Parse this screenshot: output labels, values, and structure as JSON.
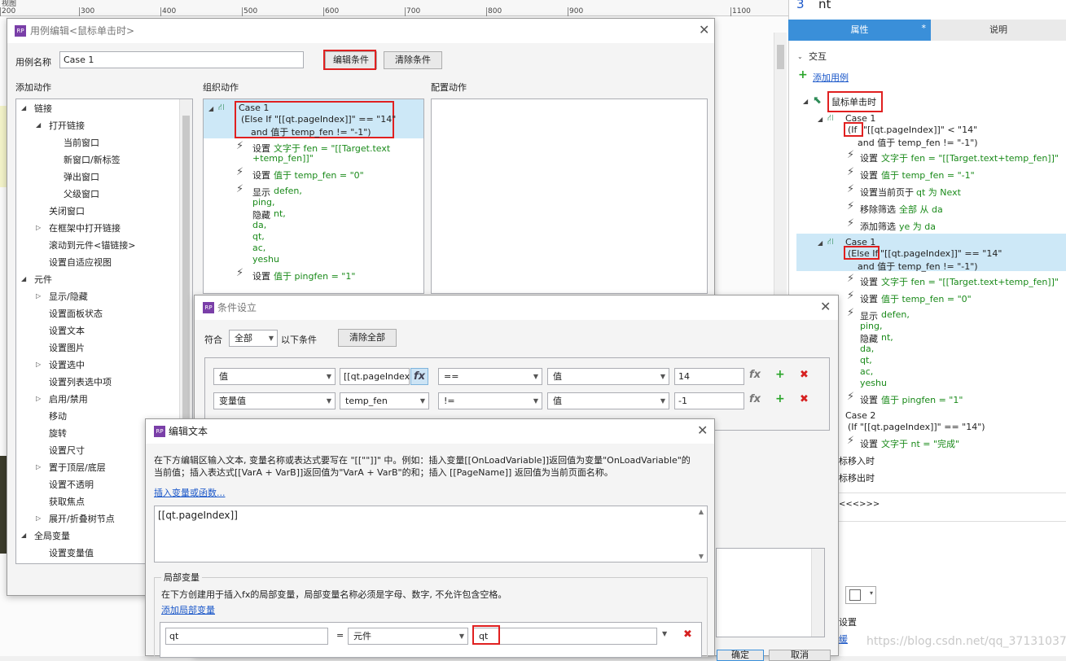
{
  "ruler": {
    "marks": [
      "200",
      "300",
      "400",
      "500",
      "600",
      "700",
      "800",
      "900",
      "1100"
    ],
    "corner": "视图"
  },
  "right_panel": {
    "top_row_num": "3",
    "top_row_text": "nt",
    "tab_properties": "属性",
    "tab_star": "*",
    "tab_notes": "说明",
    "section_interaction": "交互",
    "add_case": "添加用例",
    "event_onclick": "鼠标单击时",
    "case1_title": "Case 1",
    "case1_cond_a": "(If",
    "case1_cond_b": "\"[[qt.pageIndex]]\" < \"14\"",
    "case1_cond_c": "and 值于 temp_fen != \"-1\")",
    "case1_actions": [
      {
        "verb": "设置",
        "rest": "文字于 fen = \"[[Target.text+temp_fen]]\""
      },
      {
        "verb": "设置",
        "rest": "值于 temp_fen = \"-1\""
      },
      {
        "verb": "设置当前页于",
        "rest": "qt 为 Next"
      },
      {
        "verb": "移除筛选",
        "rest": "全部 从 da"
      },
      {
        "verb": "添加筛选",
        "rest": "ye 为 da"
      }
    ],
    "case1b_title": "Case 1",
    "case1b_cond_a": "(Else If",
    "case1b_cond_b": "\"[[qt.pageIndex]]\" == \"14\"",
    "case1b_cond_c": "and 值于 temp_fen != \"-1\")",
    "case1b_set1_verb": "设置",
    "case1b_set1_rest": "文字于 fen = \"[[Target.text+temp_fen]]\"",
    "case1b_set2_verb": "设置",
    "case1b_set2_rest": "值于 temp_fen = \"0\"",
    "case1b_show_verb": "显示",
    "case1b_show_list": [
      "defen,",
      "ping,"
    ],
    "case1b_hide_verb": "隐藏",
    "case1b_hide_list": [
      "nt,",
      "da,",
      "qt,",
      "ac,",
      "yeshu"
    ],
    "case1b_set3_verb": "设置",
    "case1b_set3_rest": "值于 pingfen = \"1\"",
    "case2_title": "Case 2",
    "case2_cond": "(If \"[[qt.pageIndex]]\" == \"14\")",
    "case2_set_verb": "设置",
    "case2_set_rest": "文字于 nt = \"完成\"",
    "event_mouseenter": "标移入时",
    "event_mouseleave": "标移出时",
    "more": "<<<>>>",
    "bottom_label1": "设置",
    "bottom_label2": "缓"
  },
  "case_editor": {
    "title": "用例编辑<鼠标单击时>",
    "case_name_label": "用例名称",
    "case_name_value": "Case 1",
    "edit_condition": "编辑条件",
    "clear_condition": "清除条件",
    "col_add_action": "添加动作",
    "col_organize": "组织动作",
    "col_configure": "配置动作",
    "tree": [
      {
        "indent": 0,
        "exp": "◢",
        "label": "链接"
      },
      {
        "indent": 1,
        "exp": "◢",
        "label": "打开链接"
      },
      {
        "indent": 2,
        "exp": "",
        "label": "当前窗口"
      },
      {
        "indent": 2,
        "exp": "",
        "label": "新窗口/新标签"
      },
      {
        "indent": 2,
        "exp": "",
        "label": "弹出窗口"
      },
      {
        "indent": 2,
        "exp": "",
        "label": "父级窗口"
      },
      {
        "indent": 1,
        "exp": "",
        "label": "关闭窗口"
      },
      {
        "indent": 1,
        "exp": "▷",
        "label": "在框架中打开链接"
      },
      {
        "indent": 1,
        "exp": "",
        "label": "滚动到元件<锚链接>"
      },
      {
        "indent": 1,
        "exp": "",
        "label": "设置自适应视图"
      },
      {
        "indent": 0,
        "exp": "◢",
        "label": "元件"
      },
      {
        "indent": 1,
        "exp": "▷",
        "label": "显示/隐藏"
      },
      {
        "indent": 1,
        "exp": "",
        "label": "设置面板状态"
      },
      {
        "indent": 1,
        "exp": "",
        "label": "设置文本"
      },
      {
        "indent": 1,
        "exp": "",
        "label": "设置图片"
      },
      {
        "indent": 1,
        "exp": "▷",
        "label": "设置选中"
      },
      {
        "indent": 1,
        "exp": "",
        "label": "设置列表选中项"
      },
      {
        "indent": 1,
        "exp": "▷",
        "label": "启用/禁用"
      },
      {
        "indent": 1,
        "exp": "",
        "label": "移动"
      },
      {
        "indent": 1,
        "exp": "",
        "label": "旋转"
      },
      {
        "indent": 1,
        "exp": "",
        "label": "设置尺寸"
      },
      {
        "indent": 1,
        "exp": "▷",
        "label": "置于顶层/底层"
      },
      {
        "indent": 1,
        "exp": "",
        "label": "设置不透明"
      },
      {
        "indent": 1,
        "exp": "",
        "label": "获取焦点"
      },
      {
        "indent": 1,
        "exp": "▷",
        "label": "展开/折叠树节点"
      },
      {
        "indent": 0,
        "exp": "◢",
        "label": "全局变量"
      },
      {
        "indent": 1,
        "exp": "",
        "label": "设置变量值"
      }
    ],
    "org_case_title": "Case 1",
    "org_case_cond1": "(Else If \"[[qt.pageIndex]]\" == \"14\"",
    "org_case_cond2": "and 值于 temp_fen != \"-1\")",
    "org_set1_verb": "设置",
    "org_set1_rest_a": "文字于 fen = \"[[Target.text",
    "org_set1_rest_b": "+temp_fen]]\"",
    "org_set2_verb": "设置",
    "org_set2_rest": "值于 temp_fen = \"0\"",
    "org_show_verb": "显示",
    "org_show_list": [
      "defen,",
      "ping,"
    ],
    "org_hide_verb": "隐藏",
    "org_hide_list": [
      "nt,",
      "da,",
      "qt,",
      "ac,",
      "yeshu"
    ],
    "org_set3_verb": "设置",
    "org_set3_rest": "值于 pingfen = \"1\""
  },
  "condition_dialog": {
    "title": "条件设立",
    "match_label": "符合",
    "match_value": "全部",
    "following": "以下条件",
    "clear_all": "清除全部",
    "rows": [
      {
        "type": "值",
        "target": "[[qt.pageIndex]]",
        "op": "==",
        "vtype": "值",
        "value": "14"
      },
      {
        "type": "变量值",
        "target": "temp_fen",
        "op": "!=",
        "vtype": "值",
        "value": "-1"
      }
    ],
    "fx": "fx"
  },
  "edit_text_dialog": {
    "title": "编辑文本",
    "desc1": "在下方编辑区输入文本, 变量名称或表达式要写在 \"[[\"\"]]\" 中。例如：插入变量[[OnLoadVariable]]返回值为变量\"OnLoadVariable\"的",
    "desc2": "当前值；插入表达式[[VarA + VarB]]返回值为\"VarA + VarB\"的和；插入 [[PageName]] 返回值为当前页面名称。",
    "insert_link": "插入变量或函数...",
    "editor_value": "[[qt.pageIndex]]",
    "local_vars_title": "局部变量",
    "local_vars_desc": "在下方创建用于插入fx的局部变量，局部变量名称必须是字母、数字, 不允许包含空格。",
    "add_local_link": "添加局部变量",
    "var_name": "qt",
    "equals": "=",
    "var_type": "元件",
    "var_target": "qt"
  },
  "bottom_buttons": {
    "ok": "确定",
    "cancel": "取消"
  },
  "watermark": "https://blog.csdn.net/qq_37131037"
}
